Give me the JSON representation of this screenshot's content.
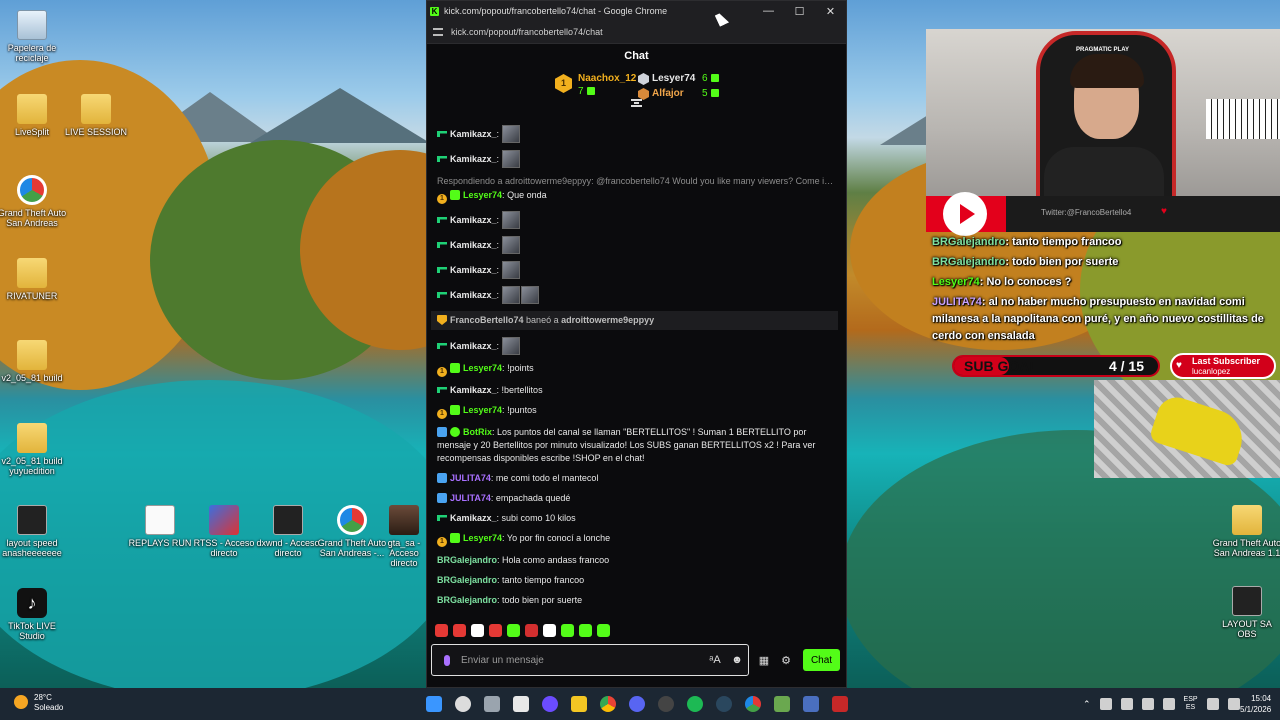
{
  "desktop": {
    "icons": [
      {
        "label": "Papelera de reciclaje"
      },
      {
        "label": "LiveSplit"
      },
      {
        "label": "LIVE SESSION"
      },
      {
        "label": "Grand Theft Auto San Andreas"
      },
      {
        "label": "RIVATUNER"
      },
      {
        "label": "v2_05_81 build"
      },
      {
        "label": "v2_05_81 build yuyuedition"
      },
      {
        "label": "layout speed anasheeeeeee"
      },
      {
        "label": "REPLAYS RUN"
      },
      {
        "label": "RTSS - Acceso directo"
      },
      {
        "label": "dxwnd - Acceso directo"
      },
      {
        "label": "Grand Theft Auto San Andreas -..."
      },
      {
        "label": "gta_sa - Acceso directo"
      },
      {
        "label": "TikTok LIVE Studio"
      },
      {
        "label": "Grand Theft Auto San Andreas 1.1"
      },
      {
        "label": "LAYOUT SA OBS"
      }
    ]
  },
  "browser": {
    "window_title": "kick.com/popout/francobertello74/chat - Google Chrome",
    "url": "kick.com/popout/francobertello74/chat",
    "controls": {
      "minimize": "—",
      "maximize": "☐",
      "close": "✕"
    }
  },
  "chat": {
    "header": "Chat",
    "leaderboard": {
      "first": {
        "rank": "1",
        "name": "Naachox_12",
        "count": "7"
      },
      "second": {
        "name": "Lesyer74",
        "count": "6"
      },
      "third": {
        "name": "Alfajor",
        "count": "5"
      }
    },
    "messages": [
      {
        "user": "Kamikazx_",
        "color": "#e9e9e9",
        "badges": [
          "mod"
        ],
        "text": "",
        "emotes": 1
      },
      {
        "user": "Kamikazx_",
        "color": "#e9e9e9",
        "badges": [
          "mod"
        ],
        "text": "",
        "emotes": 1
      },
      {
        "type": "reply",
        "text": "Respondiendo a adroittowerme9eppyy: @francobertello74 Would you like many viewers? Come in ..."
      },
      {
        "user": "Lesyer74",
        "color": "#53fc18",
        "badges": [
          "sub",
          "gift"
        ],
        "text": "Que onda"
      },
      {
        "user": "Kamikazx_",
        "color": "#e9e9e9",
        "badges": [
          "mod"
        ],
        "text": "",
        "emotes": 1
      },
      {
        "user": "Kamikazx_",
        "color": "#e9e9e9",
        "badges": [
          "mod"
        ],
        "text": "",
        "emotes": 1
      },
      {
        "user": "Kamikazx_",
        "color": "#e9e9e9",
        "badges": [
          "mod"
        ],
        "text": "",
        "emotes": 1
      },
      {
        "user": "Kamikazx_",
        "color": "#e9e9e9",
        "badges": [
          "mod"
        ],
        "text": "",
        "emotes": 2
      },
      {
        "type": "system",
        "user": "FrancoBertello74",
        "action": "baneó a",
        "target": "adroittowerme9eppyy"
      },
      {
        "user": "Kamikazx_",
        "color": "#e9e9e9",
        "badges": [
          "mod"
        ],
        "text": "",
        "emotes": 1
      },
      {
        "user": "Lesyer74",
        "color": "#53fc18",
        "badges": [
          "sub",
          "gift"
        ],
        "text": "!points"
      },
      {
        "user": "Kamikazx_",
        "color": "#e9e9e9",
        "badges": [
          "mod"
        ],
        "text": "!bertellitos"
      },
      {
        "user": "Lesyer74",
        "color": "#53fc18",
        "badges": [
          "sub",
          "gift"
        ],
        "text": "!puntos"
      },
      {
        "user": "BotRix",
        "color": "#53fc18",
        "badges": [
          "vip",
          "bot"
        ],
        "text": "Los puntos del canal se llaman \"BERTELLITOS\" ! Suman 1 BERTELLITO por mensaje y 20 Bertellitos por minuto visualizado! Los SUBS ganan BERTELLITOS x2 ! Para ver recompensas disponibles escribe !SHOP en el chat!"
      },
      {
        "user": "JULITA74",
        "color": "#a970ff",
        "badges": [
          "vip"
        ],
        "text": "me comi todo el mantecol"
      },
      {
        "user": "JULITA74",
        "color": "#a970ff",
        "badges": [
          "vip"
        ],
        "text": "empachada quedé"
      },
      {
        "user": "Kamikazx_",
        "color": "#e9e9e9",
        "badges": [
          "mod"
        ],
        "text": "subi como 10 kilos"
      },
      {
        "user": "Lesyer74",
        "color": "#53fc18",
        "badges": [
          "sub",
          "gift"
        ],
        "text": "Yo por fin conocí a lonche"
      },
      {
        "user": "BRGalejandro",
        "color": "#7de0a0",
        "badges": [],
        "text": "Hola como andass francoo"
      },
      {
        "user": "BRGalejandro",
        "color": "#7de0a0",
        "badges": [],
        "text": "tanto tiempo francoo"
      },
      {
        "user": "BRGalejandro",
        "color": "#7de0a0",
        "badges": [],
        "text": "todo bien por suerte"
      },
      {
        "user": "Lesyer74",
        "color": "#53fc18",
        "badges": [
          "sub",
          "gift"
        ],
        "text": "No lo conoces ?"
      },
      {
        "user": "JULITA74",
        "color": "#a970ff",
        "badges": [
          "vip"
        ],
        "text": "al no haber mucho presupuesto en navidad comi milanesa a la napolitana con puré, y en año nuevo costillitas de cerdo con ensalada"
      }
    ],
    "input_placeholder": "Enviar un mensaje",
    "send_label": "Chat",
    "emote_colors": [
      "#e53935",
      "#e53935",
      "#ffffff",
      "#e53935",
      "#53fc18",
      "#d32f2f",
      "#ffffff",
      "#53fc18",
      "#53fc18",
      "#53fc18"
    ]
  },
  "overlay": {
    "youtube_handle": "Twitter:@FrancoBertello4",
    "chat": [
      {
        "user": "BRGalejandro",
        "text": ": tanto tiempo francoo"
      },
      {
        "user": "BRGalejandro",
        "text": ": todo bien por suerte"
      },
      {
        "user": "Lesyer74",
        "text": ": No lo conoces ?"
      },
      {
        "user": "JULITA74",
        "text": ": al no haber mucho presupuesto en navidad comi milanesa a la napolitana con puré, y en año nuevo costillitas de cerdo con ensalada"
      }
    ],
    "subgoal_label": "SUB GOAL",
    "subgoal_count": "4 / 15",
    "subgoal_progress": 0.27,
    "last_sub_title": "Last Subscriber",
    "last_sub_name": "lucanlopez",
    "cam_brand": "PRAGMATIC PLAY"
  },
  "taskbar": {
    "weather_temp": "28°C",
    "weather_desc": "Soleado",
    "lang_top": "ESP",
    "lang_bottom": "ES",
    "time": "15:04",
    "date": "5/1/2026"
  },
  "colors": {
    "kick_green": "#53fc18",
    "chat_bg": "#0b0b0d"
  }
}
